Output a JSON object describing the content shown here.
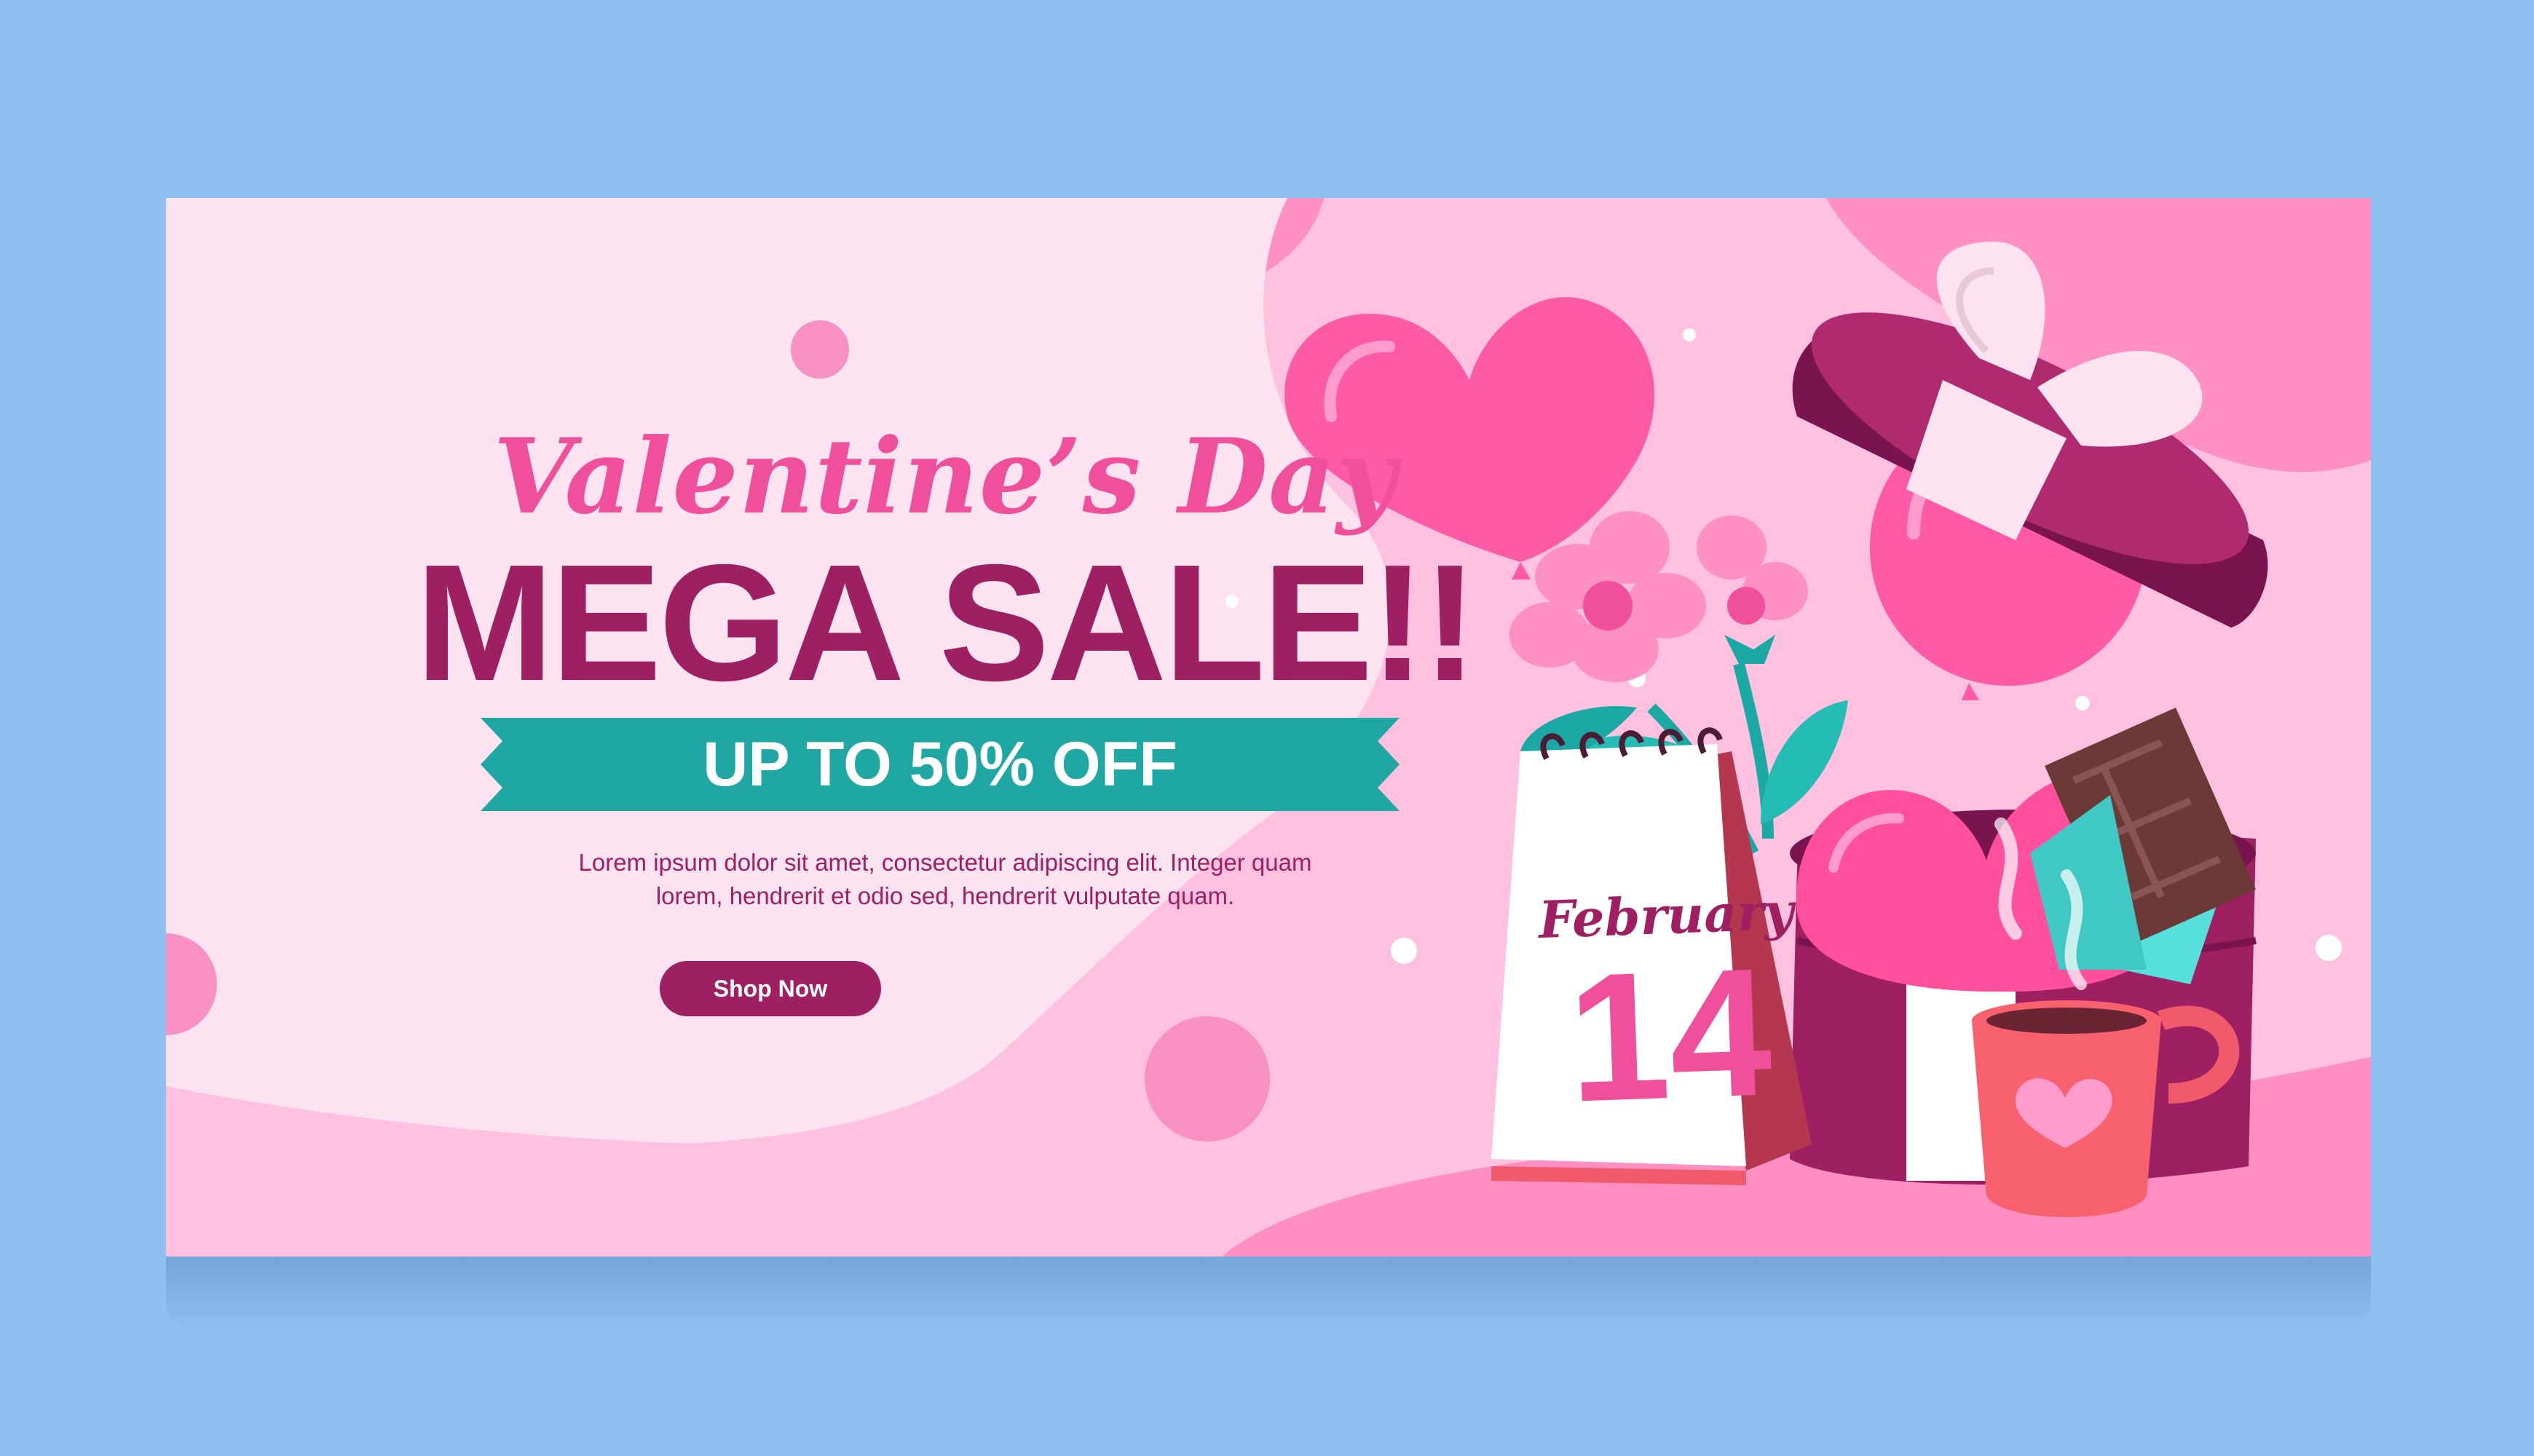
{
  "headline": {
    "script_title": "Valentine’s Day",
    "main_title": "MEGA SALE!!",
    "discount_ribbon": "UP TO 50% OFF"
  },
  "body": {
    "line1": "Lorem ipsum dolor sit amet, consectetur adipiscing elit. Integer quam",
    "line2": "lorem, hendrerit et odio sed, hendrerit vulputate quam."
  },
  "cta": {
    "label": "Shop Now"
  },
  "calendar": {
    "month": "February",
    "day": "14"
  },
  "colors": {
    "page_background": "#8ec0f2",
    "banner_pink": "#ffbfdc",
    "light_pink": "#fde3ef",
    "accent_pink": "#f0509b",
    "plum": "#9e1f62",
    "teal": "#18a9a5",
    "white": "#ffffff"
  },
  "icons": [
    "heart-balloon-icon",
    "gift-box-icon",
    "flower-icon",
    "chocolate-bar-icon",
    "coffee-mug-icon",
    "calendar-icon"
  ]
}
